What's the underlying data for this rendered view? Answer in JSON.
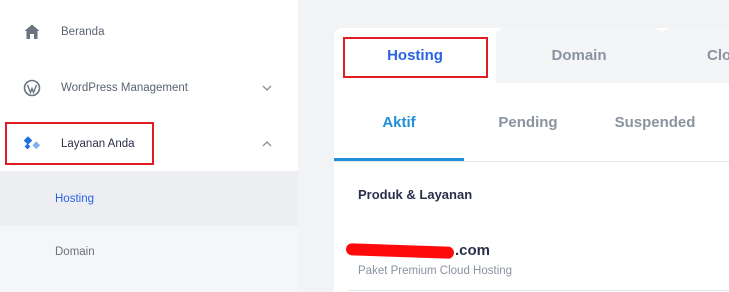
{
  "sidebar": {
    "items": [
      {
        "label": "Beranda",
        "icon": "home-icon"
      },
      {
        "label": "WordPress Management",
        "icon": "wordpress-icon"
      },
      {
        "label": "Layanan Anda",
        "icon": "services-icon"
      }
    ],
    "sub_items": [
      {
        "label": "Hosting",
        "active": true
      },
      {
        "label": "Domain",
        "active": false
      }
    ]
  },
  "main": {
    "top_tabs": [
      {
        "label": "Hosting",
        "active": true
      },
      {
        "label": "Domain",
        "active": false
      },
      {
        "label": "Clo",
        "active": false
      }
    ],
    "status_tabs": [
      {
        "label": "Aktif",
        "active": true
      },
      {
        "label": "Pending",
        "active": false
      },
      {
        "label": "Suspended",
        "active": false
      }
    ],
    "section_title": "Produk & Layanan",
    "product": {
      "domain_suffix": ".com",
      "package": "Paket Premium Cloud Hosting"
    }
  },
  "colors": {
    "accent_blue": "#2a63e4",
    "tab_blue": "#1e8fd8",
    "highlight_red": "#e01c24",
    "sidebar_active_bg": "#eceef1"
  }
}
